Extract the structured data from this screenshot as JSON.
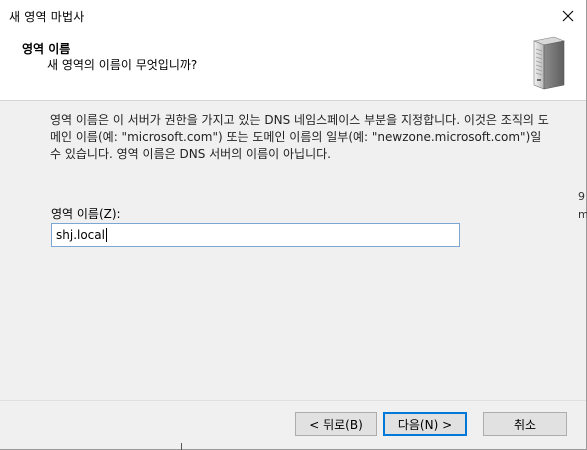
{
  "window": {
    "title": "새 영역 마법사",
    "close_label": "×"
  },
  "header": {
    "title": "영역 이름",
    "subtitle": "새 영역의 이름이 무엇입니까?",
    "icon": "server-icon"
  },
  "content": {
    "description": "영역 이름은 이 서버가 권한을 가지고 있는 DNS 네임스페이스 부분을 지정합니다. 이것은 조직의 도메인 이름(예: \"microsoft.com\") 또는 도메인 이름의 일부(예: \"newzone.microsoft.com\")일 수 있습니다. 영역 이름은 DNS 서버의 이름이 아닙니다.",
    "zone_name_label": "영역 이름(Z):",
    "zone_name_value": "shj.local"
  },
  "buttons": {
    "back": "< 뒤로(B)",
    "next": "다음(N) >",
    "cancel": "취소"
  },
  "edge": {
    "mark1": "9",
    "mark2": "m"
  },
  "colors": {
    "focus_border": "#0078d7",
    "input_border": "#7aa7d6",
    "button_bg": "#e1e1e1"
  }
}
